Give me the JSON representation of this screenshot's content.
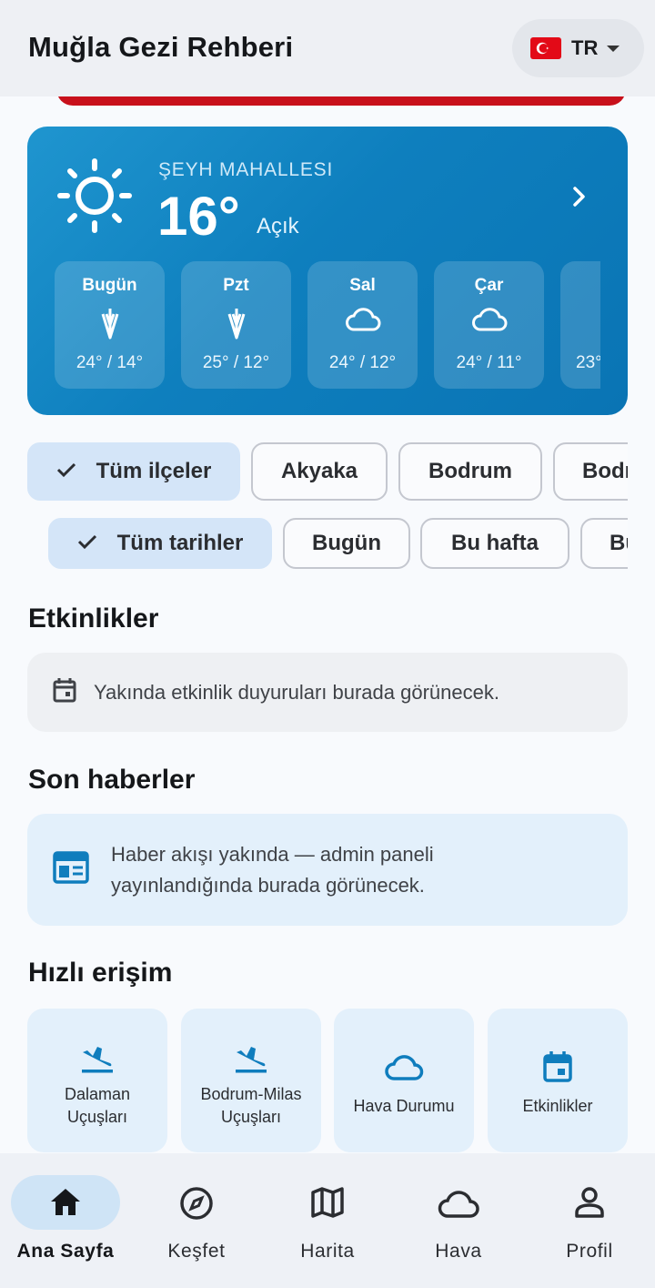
{
  "app": {
    "title": "Muğla Gezi Rehberi",
    "language": {
      "code": "TR",
      "flag": "turkey-flag"
    }
  },
  "weather": {
    "location": "ŞEYH MAHALLESI",
    "temperature": "16°",
    "condition": "Açık",
    "forecast": [
      {
        "day": "Bugün",
        "icon": "rain-icon",
        "range": "24° / 14°"
      },
      {
        "day": "Pzt",
        "icon": "rain-icon",
        "range": "25° / 12°"
      },
      {
        "day": "Sal",
        "icon": "cloud-icon",
        "range": "24° / 12°"
      },
      {
        "day": "Çar",
        "icon": "cloud-icon",
        "range": "24° / 11°"
      },
      {
        "day": "",
        "icon": "",
        "range": "23°"
      }
    ]
  },
  "filters": {
    "districts": [
      "Tüm ilçeler",
      "Akyaka",
      "Bodrum",
      "Bodrum"
    ],
    "dates": [
      "Tüm tarihler",
      "Bugün",
      "Bu hafta",
      "Bu"
    ]
  },
  "events": {
    "title": "Etkinlikler",
    "empty_text": "Yakında etkinlik duyuruları burada görünecek."
  },
  "news": {
    "title": "Son haberler",
    "empty_line1": "Haber akışı yakında — admin paneli",
    "empty_line2": "yayınlandığında burada görünecek."
  },
  "quick_access": {
    "title": "Hızlı erişim",
    "items": [
      {
        "line1": "Dalaman",
        "line2": "Uçuşları",
        "icon": "flight-land-icon"
      },
      {
        "line1": "Bodrum-Milas",
        "line2": "Uçuşları",
        "icon": "flight-land-icon"
      },
      {
        "line1": "Hava Durumu",
        "line2": "",
        "icon": "cloud-icon"
      },
      {
        "line1": "Etkinlikler",
        "line2": "",
        "icon": "calendar-icon"
      }
    ]
  },
  "nav": {
    "items": [
      {
        "label": "Ana Sayfa",
        "icon": "home-icon",
        "active": true
      },
      {
        "label": "Keşfet",
        "icon": "compass-icon",
        "active": false
      },
      {
        "label": "Harita",
        "icon": "map-icon",
        "active": false
      },
      {
        "label": "Hava",
        "icon": "cloud-icon",
        "active": false
      },
      {
        "label": "Profil",
        "icon": "person-icon",
        "active": false
      }
    ]
  },
  "colors": {
    "accent": "#0f7dbd",
    "selected_chip": "#d4e5f8",
    "brand_red": "#c8101b"
  }
}
